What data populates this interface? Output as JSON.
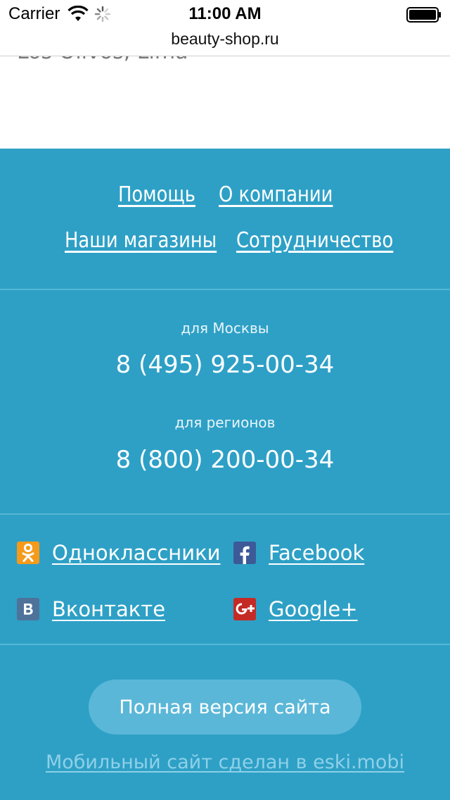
{
  "status_bar": {
    "carrier": "Carrier",
    "time": "11:00 AM"
  },
  "browser": {
    "url": "beauty-shop.ru"
  },
  "content": {
    "address_partial": "Los Olivos, Lima"
  },
  "footer": {
    "nav_links": {
      "help": "Помощь",
      "about": "О компании",
      "stores": "Наши магазины",
      "partnership": "Сотрудничество"
    },
    "phones": {
      "moscow_caption": "для Москвы",
      "moscow_number": "8 (495) 925-00-34",
      "regions_caption": "для регионов",
      "regions_number": "8 (800) 200-00-34"
    },
    "social": {
      "odnoklassniki": "Одноклассники",
      "facebook": "Facebook",
      "vkontakte": "Вконтакте",
      "google_plus": "Google+"
    },
    "full_version_button": "Полная версия сайта",
    "credit": "Мобильный сайт сделан в eski.mobi"
  },
  "colors": {
    "footer_bg": "#2ea0c6",
    "button_bg": "#5bb7d8",
    "odnoklassniki": "#f59a1a",
    "facebook": "#3d5a98",
    "vkontakte": "#4e729a",
    "google_plus": "#c42b24"
  },
  "icons": [
    "wifi-icon",
    "activity-spinner-icon",
    "battery-icon",
    "odnoklassniki-icon",
    "facebook-icon",
    "vkontakte-icon",
    "google-plus-icon"
  ]
}
